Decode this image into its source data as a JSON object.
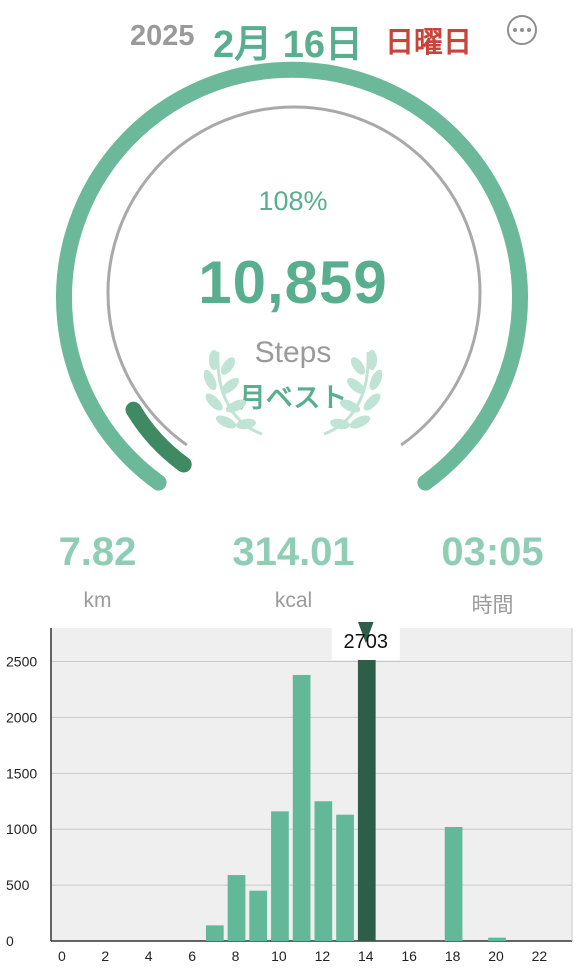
{
  "header": {
    "year": "2025",
    "date": "2月 16日",
    "weekday": "日曜日",
    "more_icon": "ellipsis-circle-icon"
  },
  "summary": {
    "percent": "108%",
    "percent_value": 108,
    "steps": "10,859",
    "steps_label": "Steps",
    "badge": "月ベスト",
    "badge_icon": "laurel-icon"
  },
  "stats": [
    {
      "value": "7.82",
      "unit": "km"
    },
    {
      "value": "314.01",
      "unit": "kcal"
    },
    {
      "value": "03:05",
      "unit": "時間"
    }
  ],
  "colors": {
    "accent": "#5aae90",
    "accent_light": "#8fcdb5",
    "bar": "#64b89a",
    "bar_selected": "#2d5e4a",
    "weekday": "#c8443a"
  },
  "chart_data": {
    "type": "bar",
    "x": [
      0,
      1,
      2,
      3,
      4,
      5,
      6,
      7,
      8,
      9,
      10,
      11,
      12,
      13,
      14,
      15,
      16,
      17,
      18,
      19,
      20,
      21,
      22,
      23
    ],
    "values": [
      0,
      0,
      0,
      0,
      0,
      0,
      0,
      140,
      590,
      450,
      1160,
      2380,
      1250,
      1130,
      2703,
      0,
      0,
      0,
      1020,
      0,
      30,
      0,
      0,
      0
    ],
    "xticks": [
      "0",
      "2",
      "4",
      "6",
      "8",
      "10",
      "12",
      "14",
      "16",
      "18",
      "20",
      "22"
    ],
    "yticks": [
      "0",
      "500",
      "1000",
      "1500",
      "2000",
      "2500"
    ],
    "ylim": [
      0,
      2800
    ],
    "selected_index": 14,
    "tooltip": "2703",
    "grid": true
  }
}
